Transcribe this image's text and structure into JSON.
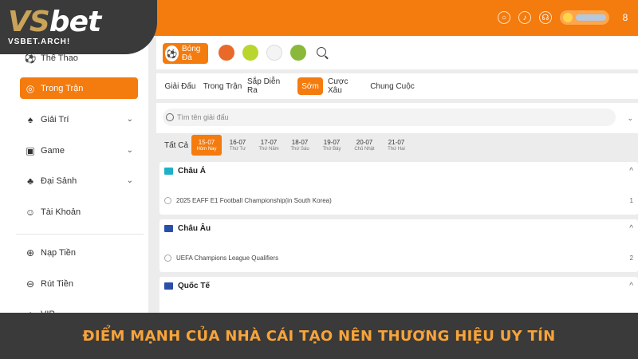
{
  "brand": {
    "logo_main_vs": "VS",
    "logo_main_bet": "bet",
    "logo_sub": "VSBET.ARCH!"
  },
  "topbar": {
    "avatar_letter": "8"
  },
  "sidebar": {
    "items": [
      {
        "label": "Thể Thao",
        "icon": "soccer-ball-icon"
      },
      {
        "label": "Trong Trận",
        "icon": "live-icon",
        "active": true
      },
      {
        "label": "Giải Trí",
        "icon": "spade-icon",
        "expandable": true
      },
      {
        "label": "Game",
        "icon": "game-icon",
        "expandable": true
      },
      {
        "label": "Đại Sảnh",
        "icon": "hall-icon",
        "expandable": true
      },
      {
        "label": "Tài Khoản",
        "icon": "account-icon"
      },
      {
        "label": "Nạp Tiền",
        "icon": "deposit-icon"
      },
      {
        "label": "Rút Tiền",
        "icon": "withdraw-icon"
      },
      {
        "label": "VIP",
        "icon": "vip-icon"
      }
    ]
  },
  "sports": {
    "active_label": "Bóng Đá"
  },
  "tabs": [
    "Giải Đấu",
    "Trong Trận",
    "Sắp Diễn Ra",
    "Sớm",
    "Cược Xâu",
    "Chung Cuộc"
  ],
  "active_tab": "Sớm",
  "search": {
    "placeholder": "Tìm tên giải đấu"
  },
  "dates": {
    "all_label": "Tất Cả",
    "items": [
      {
        "date": "15-07",
        "day": "Hôm Nay",
        "active": true
      },
      {
        "date": "16-07",
        "day": "Thứ Tư"
      },
      {
        "date": "17-07",
        "day": "Thứ Năm"
      },
      {
        "date": "18-07",
        "day": "Thứ Sáu"
      },
      {
        "date": "19-07",
        "day": "Thứ Bảy"
      },
      {
        "date": "20-07",
        "day": "Chủ Nhật"
      },
      {
        "date": "21-07",
        "day": "Thứ Hai"
      }
    ]
  },
  "leagues": [
    {
      "region": "Châu Á",
      "flag_color": "#1fb0c9",
      "match": "2025 EAFF E1 Football Championship(in South Korea)",
      "count": "1"
    },
    {
      "region": "Châu Âu",
      "flag_color": "#2a4fa8",
      "match": "UEFA Champions League Qualifiers",
      "count": "2"
    },
    {
      "region": "Quốc Tế",
      "flag_color": "#2a4fa8",
      "match": "",
      "count": ""
    }
  ],
  "banner": {
    "text": "ĐIỂM MẠNH CỦA NHÀ CÁI TẠO NÊN THƯƠNG HIỆU UY TÍN"
  },
  "colors": {
    "accent": "#f47b0e",
    "dark": "#3a3a3a",
    "banner_text": "#f8a43a"
  }
}
